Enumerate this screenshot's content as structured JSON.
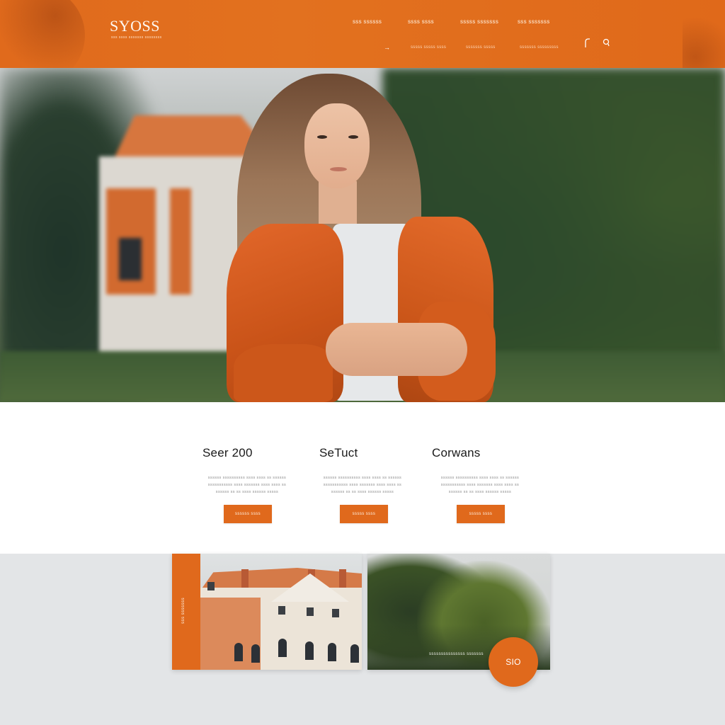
{
  "header": {
    "logo": "SYOSS",
    "logo_tagline": "sss ssss sssssss ssssssss",
    "nav_primary": [
      "sss ssssss",
      "ssss ssss",
      "sssss sssssss",
      "sss sssssss"
    ],
    "nav_secondary": [
      "sssss sssss ssss",
      "sssssss sssss",
      "sssssss sssssssss"
    ],
    "icons": [
      "arrow-icon",
      "user-icon",
      "search-icon"
    ]
  },
  "hero": {
    "image": "woman-in-orange-jacket-photo"
  },
  "features": [
    {
      "title": "Seer 200",
      "description": "ssssss ssssssssss ssss ssss ss ssssss sssssssssss ssss sssssss ssss ssss ss ssssss ss ss ssss ssssss sssss",
      "button": "ssssss ssss"
    },
    {
      "title": "SeTuct",
      "description": "ssssss ssssssssss ssss ssss ss ssssss sssssssssss ssss sssssss ssss ssss ss ssssss ss ss ssss ssssss sssss",
      "button": "sssss ssss"
    },
    {
      "title": "Corwans",
      "description": "ssssss ssssssssss ssss ssss ss ssssss sssssssssss ssss sssssss ssss ssss ss ssssss ss ss ssss ssssss sssss",
      "button": "sssss ssss"
    }
  ],
  "gallery": {
    "left_strip_label": "sss sssssss",
    "right_caption": "sssssssssssssss sssssss",
    "fab_label": "SIO"
  },
  "colors": {
    "accent": "#e0691c",
    "header_bg": "#e2711f",
    "page_bg": "#e3e5e7"
  }
}
